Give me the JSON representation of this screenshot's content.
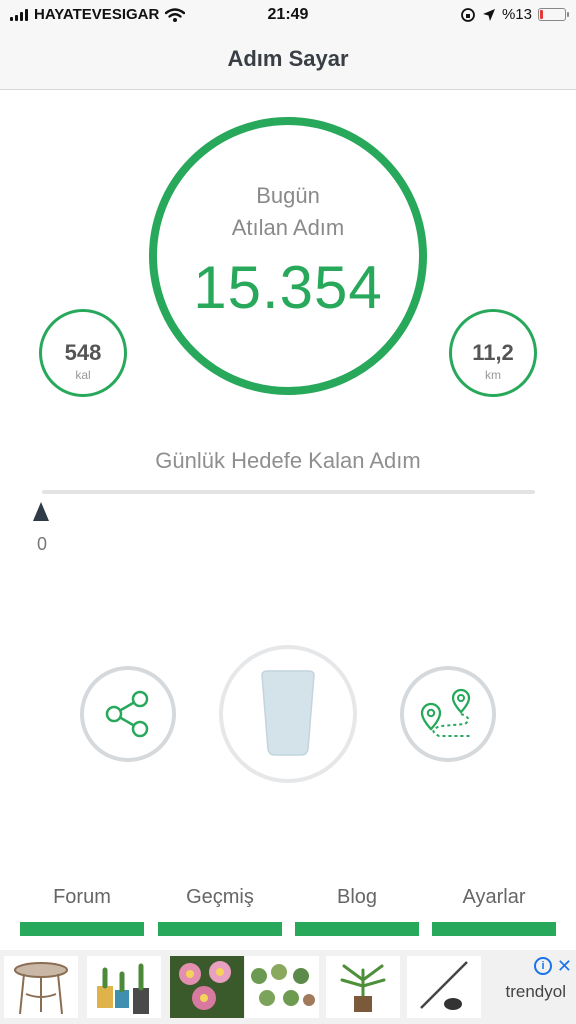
{
  "status_bar": {
    "carrier": "HAYATEVESIGAR",
    "time": "21:49",
    "battery": "%13",
    "battery_level": 0.13
  },
  "nav": {
    "title": "Adım Sayar"
  },
  "today": {
    "line1": "Bugün",
    "line2": "Atılan Adım",
    "steps": "15.354"
  },
  "calories": {
    "value": "548",
    "unit": "kal"
  },
  "distance": {
    "value": "11,2",
    "unit": "km"
  },
  "goal": {
    "label": "Günlük Hedefe Kalan Adım",
    "remaining": "0",
    "progress": 0
  },
  "actions": {
    "share_icon": "share-icon",
    "water_icon": "water-glass-icon",
    "route_icon": "route-map-icon"
  },
  "tabs": [
    {
      "label": "Forum"
    },
    {
      "label": "Geçmiş"
    },
    {
      "label": "Blog"
    },
    {
      "label": "Ayarlar"
    }
  ],
  "ad": {
    "brand": "trendyol",
    "close": "✕",
    "info": "i",
    "products": [
      "table-image",
      "cactus-pots-image",
      "flower-image",
      "succulents-image",
      "palm-plant-image",
      "pen-image"
    ]
  },
  "colors": {
    "accent": "#27a85a",
    "glass": "#d4e2ea",
    "text_dark": "#3a3f46"
  }
}
